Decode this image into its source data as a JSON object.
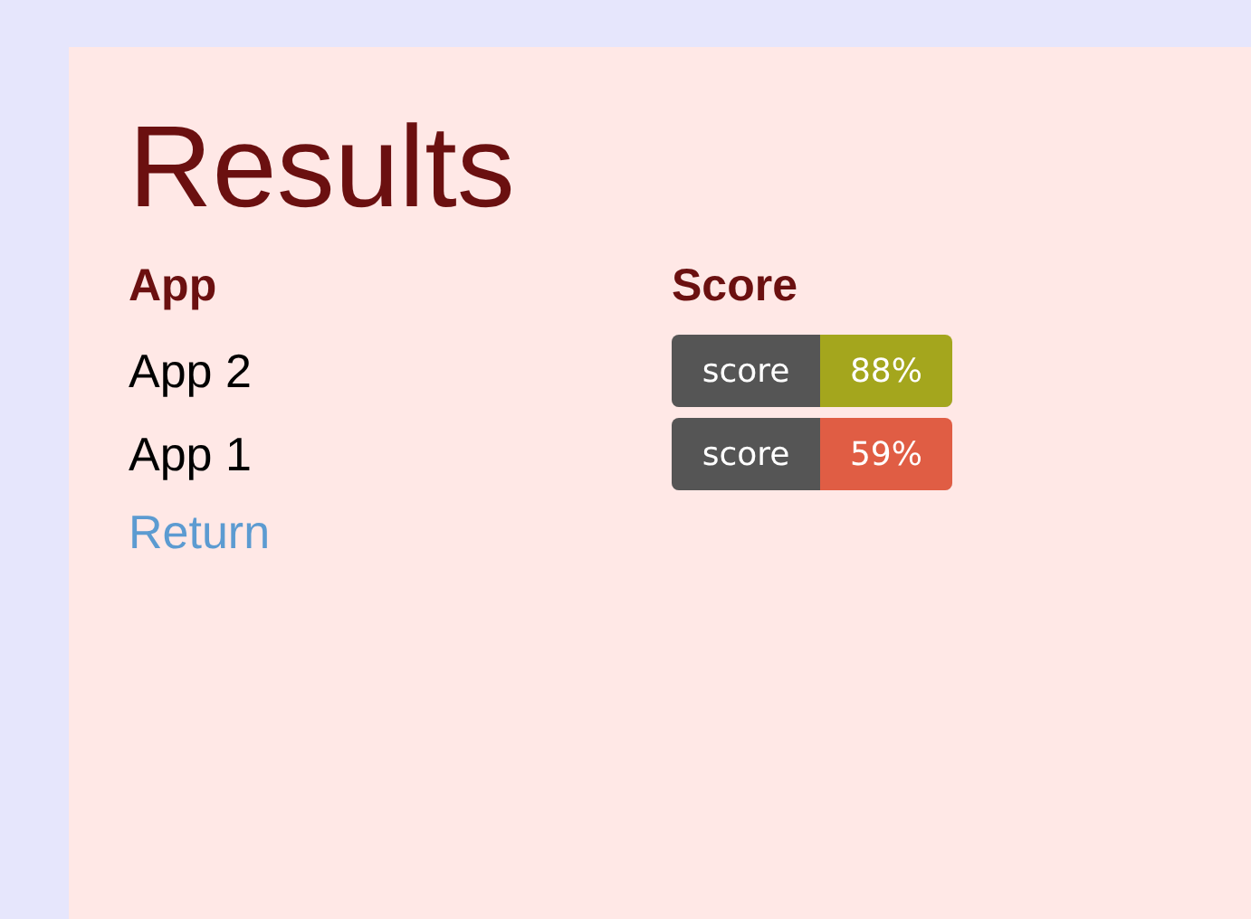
{
  "title": "Results",
  "columns": [
    "App",
    "Score"
  ],
  "rows": [
    {
      "app": "App 2",
      "badge_label": "score",
      "badge_value": "88%",
      "color": "#a4a61d"
    },
    {
      "app": "App 1",
      "badge_label": "score",
      "badge_value": "59%",
      "color": "#e05d44"
    }
  ],
  "link": "Return"
}
